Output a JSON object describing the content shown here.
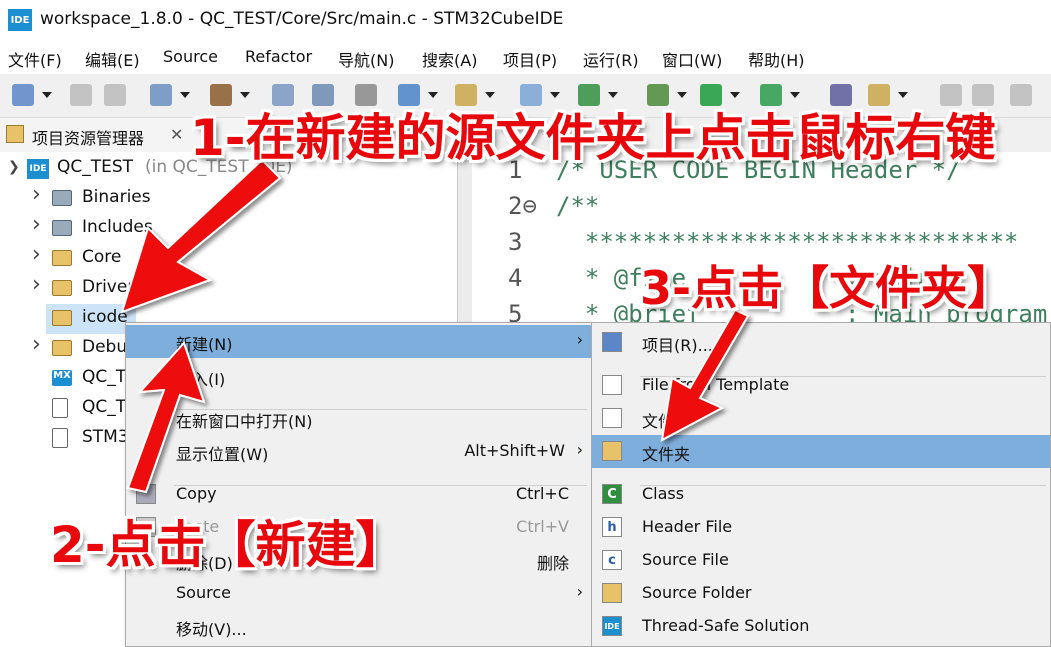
{
  "window": {
    "title": "workspace_1.8.0 - QC_TEST/Core/Src/main.c - STM32CubeIDE",
    "icon_text": "IDE"
  },
  "menubar": [
    "文件(F)",
    "编辑(E)",
    "Source",
    "Refactor",
    "导航(N)",
    "搜索(A)",
    "项目(P)",
    "运行(R)",
    "窗口(W)",
    "帮助(H)"
  ],
  "explorer": {
    "tab_label": "项目资源管理器",
    "close": "✕",
    "project": {
      "name": "QC_TEST",
      "suffix": "(in QC_TEST_IDE)",
      "icon_text": "IDE"
    },
    "items": [
      {
        "label": "Binaries",
        "icon": "binaries-icon",
        "expandable": true
      },
      {
        "label": "Includes",
        "icon": "includes-icon",
        "expandable": true
      },
      {
        "label": "Core",
        "icon": "source-folder-icon",
        "expandable": true
      },
      {
        "label": "Drivers",
        "icon": "source-folder-icon",
        "expandable": true
      },
      {
        "label": "icode",
        "icon": "source-folder-icon",
        "expandable": false,
        "selected": true
      },
      {
        "label": "Debug",
        "icon": "folder-icon",
        "expandable": true
      },
      {
        "label": "QC_TEST.ioc",
        "icon": "mx-icon",
        "icon_text": "MX",
        "expandable": false
      },
      {
        "label": "QC_TEST Debug.launch",
        "icon": "file-icon",
        "expandable": false
      },
      {
        "label": "STM32F103C8TX_FLASH.ld",
        "icon": "ld-file-icon",
        "expandable": false
      }
    ]
  },
  "editor": {
    "lines": [
      {
        "n": "1",
        "text": "/* USER CODE BEGIN Header */"
      },
      {
        "n": "2⊖",
        "text": "/**"
      },
      {
        "n": "3",
        "text": "  ******************************"
      },
      {
        "n": "4",
        "text": "  * @file           : main.c"
      },
      {
        "n": "5",
        "text": "  * @brief          : Main program"
      }
    ]
  },
  "context_menu": {
    "items": [
      {
        "label": "新建(N)",
        "submenu": true,
        "highlighted": true
      },
      {
        "label": "导入(I)"
      },
      {
        "sep": true
      },
      {
        "label": "在新窗口中打开(N)"
      },
      {
        "label": "显示位置(W)",
        "shortcut": "Alt+Shift+W",
        "submenu": true
      },
      {
        "sep": true
      },
      {
        "label": "Copy",
        "shortcut": "Ctrl+C",
        "icon": "copy-icon"
      },
      {
        "label": "Paste",
        "shortcut": "Ctrl+V",
        "icon": "paste-icon",
        "disabled": true
      },
      {
        "label": "删除(D)",
        "shortcut": "删除",
        "icon": "delete-icon"
      },
      {
        "label": "Source",
        "submenu": true
      },
      {
        "label": "移动(V)..."
      }
    ]
  },
  "submenu": {
    "items": [
      {
        "label": "项目(R)...",
        "icon": "new-project-icon"
      },
      {
        "sep": true
      },
      {
        "label": "File from Template",
        "icon": "new-file-icon"
      },
      {
        "label": "文件",
        "icon": "new-file-icon"
      },
      {
        "label": "文件夹",
        "icon": "new-folder-icon",
        "highlighted": true
      },
      {
        "sep": true
      },
      {
        "label": "Class",
        "icon": "class-icon",
        "icon_text": "C"
      },
      {
        "label": "Header File",
        "icon": "header-file-icon",
        "icon_text": "h"
      },
      {
        "label": "Source File",
        "icon": "source-file-icon",
        "icon_text": "c"
      },
      {
        "label": "Source Folder",
        "icon": "source-folder-icon"
      },
      {
        "label": "Thread-Safe Solution",
        "icon": "ide-icon",
        "icon_text": "IDE"
      }
    ]
  },
  "annotations": {
    "step1": "1-在新建的源文件夹上点击鼠标右键",
    "step2": "2-点击【新建】",
    "step3": "3-点击【文件夹】"
  },
  "colors": {
    "highlight": "#7eaedc",
    "annotation": "#e8070b",
    "ide_blue": "#1c8fd1",
    "comment_green": "#3f7f5f"
  }
}
